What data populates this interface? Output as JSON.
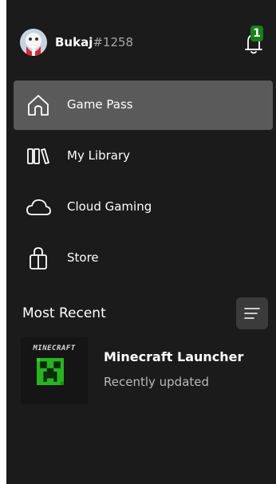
{
  "user": {
    "name": "Bukaj",
    "tag": "#1258",
    "notification_count": "1"
  },
  "nav": {
    "items": [
      {
        "label": "Game Pass",
        "icon": "home-icon",
        "active": true
      },
      {
        "label": "My Library",
        "icon": "library-icon",
        "active": false
      },
      {
        "label": "Cloud Gaming",
        "icon": "cloud-icon",
        "active": false
      },
      {
        "label": "Store",
        "icon": "store-bag-icon",
        "active": false
      }
    ]
  },
  "recent": {
    "title": "Most Recent",
    "sort_icon": "sort-lines-icon",
    "items": [
      {
        "thumb_text": "MINECRAFT",
        "title": "Minecraft Launcher",
        "status": "Recently updated"
      }
    ]
  },
  "colors": {
    "panel_bg": "#1b1b1b",
    "active_item_bg": "#5a5a5a",
    "badge_green": "#1a7f1a",
    "creeper_green": "#27b323"
  }
}
